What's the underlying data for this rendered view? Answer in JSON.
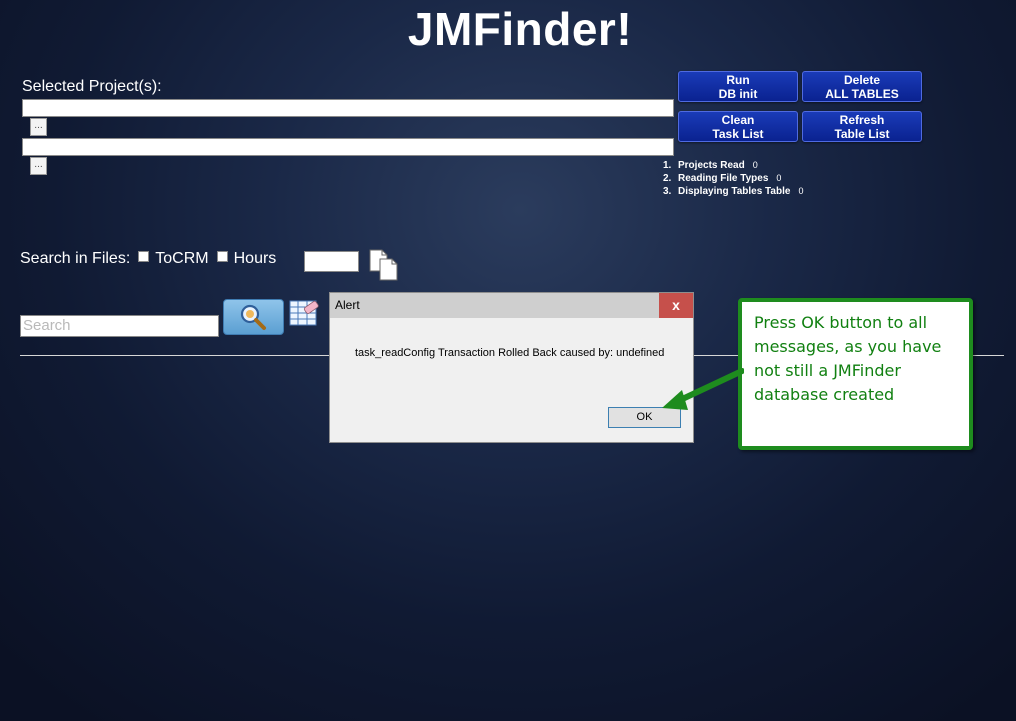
{
  "header": {
    "title": "JMFinder!"
  },
  "projects": {
    "label": "Selected Project(s):",
    "browse_label": "..."
  },
  "actions": {
    "run_db_init": [
      "Run",
      "DB init"
    ],
    "delete_all_tables": [
      "Delete",
      "ALL TABLES"
    ],
    "clean_task_list": [
      "Clean",
      "Task List"
    ],
    "refresh_table_list": [
      "Refresh",
      "Table List"
    ]
  },
  "steps": [
    {
      "num": "1.",
      "label": "Projects Read",
      "count": "0"
    },
    {
      "num": "2.",
      "label": "Reading File Types",
      "count": "0"
    },
    {
      "num": "3.",
      "label": "Displaying Tables Table",
      "count": "0"
    }
  ],
  "filters": {
    "search_in_files": "Search in Files:",
    "to_crm": "ToCRM",
    "hours": "Hours"
  },
  "search": {
    "placeholder": "Search"
  },
  "alert": {
    "title": "Alert",
    "close": "x",
    "message": "task_readConfig Transaction Rolled Back caused by: undefined",
    "ok": "OK"
  },
  "callout": {
    "text": "Press OK button to all messages, as you have not still a JMFinder database created",
    "color": "#118011"
  }
}
